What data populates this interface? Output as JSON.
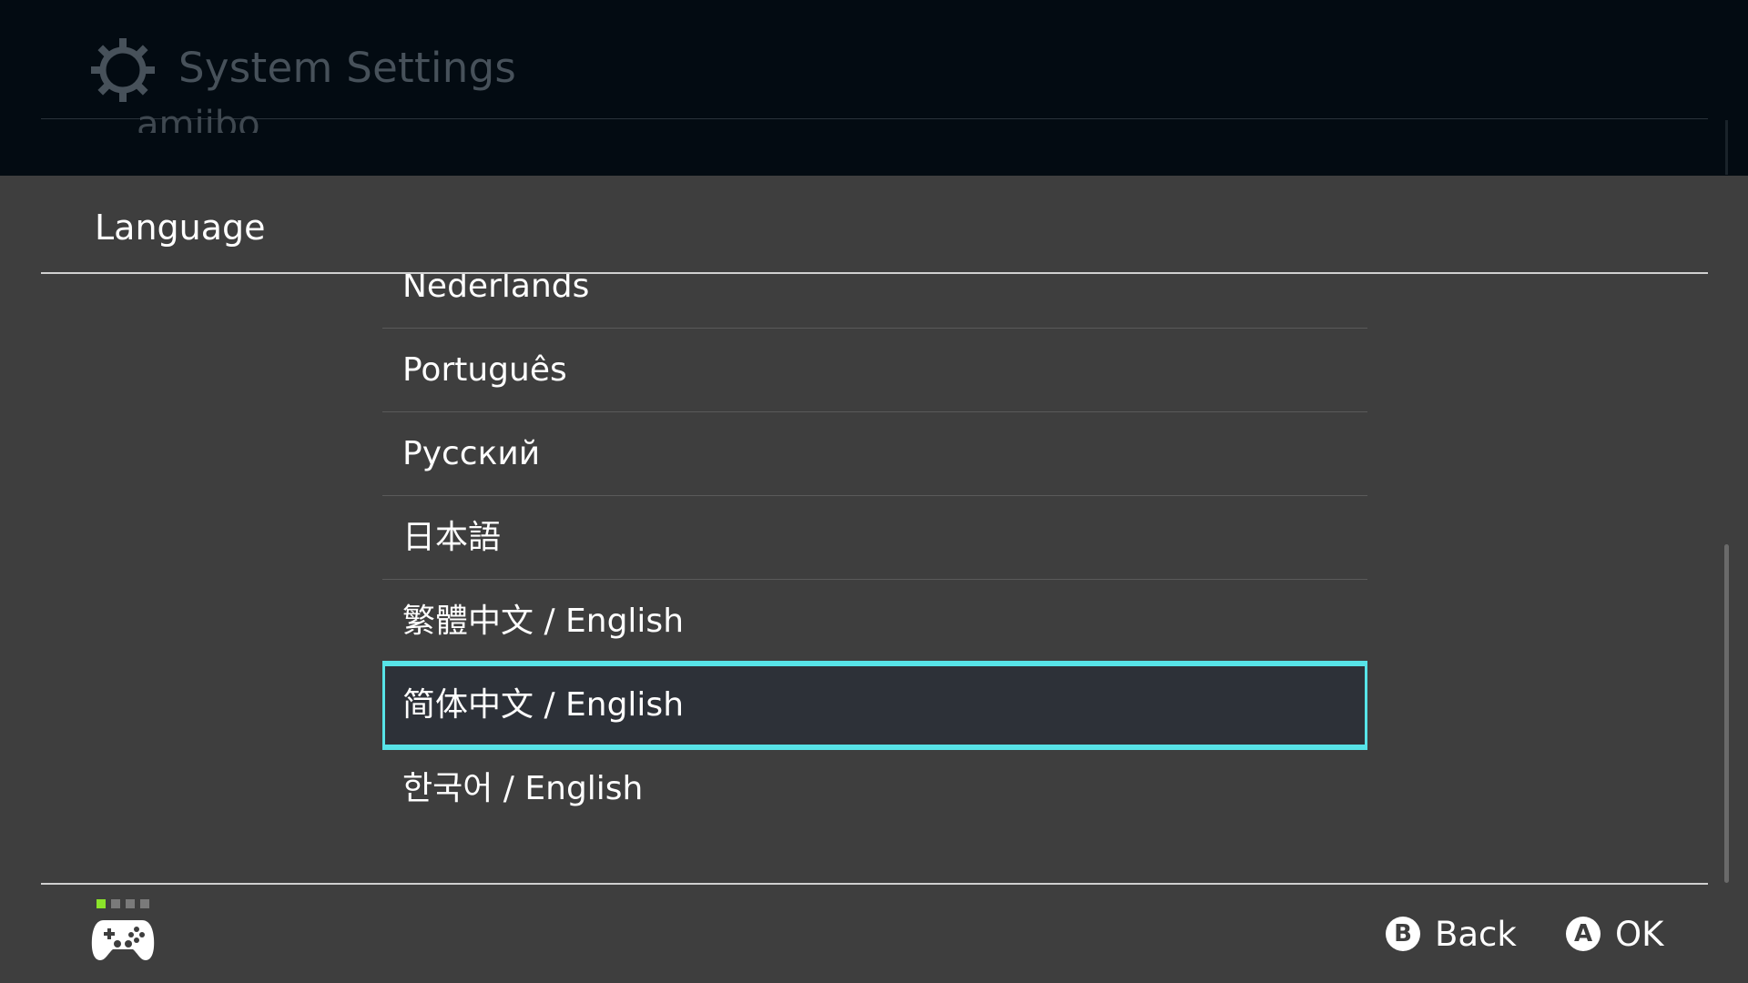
{
  "background": {
    "title": "System Settings",
    "peek_item": "amiibo",
    "icon": "gear-icon"
  },
  "panel": {
    "title": "Language",
    "items": [
      {
        "label": "Nederlands"
      },
      {
        "label": "Português"
      },
      {
        "label": "Русский"
      },
      {
        "label": "日本語"
      },
      {
        "label": "繁體中文 / English"
      },
      {
        "label": "简体中文 / English"
      },
      {
        "label": "한국어 / English"
      }
    ],
    "selected_index": 5
  },
  "footer": {
    "back": {
      "key": "B",
      "label": "Back"
    },
    "ok": {
      "key": "A",
      "label": "OK"
    },
    "controller_icon": "gamepad-icon",
    "player_indicator": {
      "count": 4,
      "active": 1
    }
  },
  "colors": {
    "selection_border": "#57e3e7",
    "player_active": "#8be32a"
  }
}
